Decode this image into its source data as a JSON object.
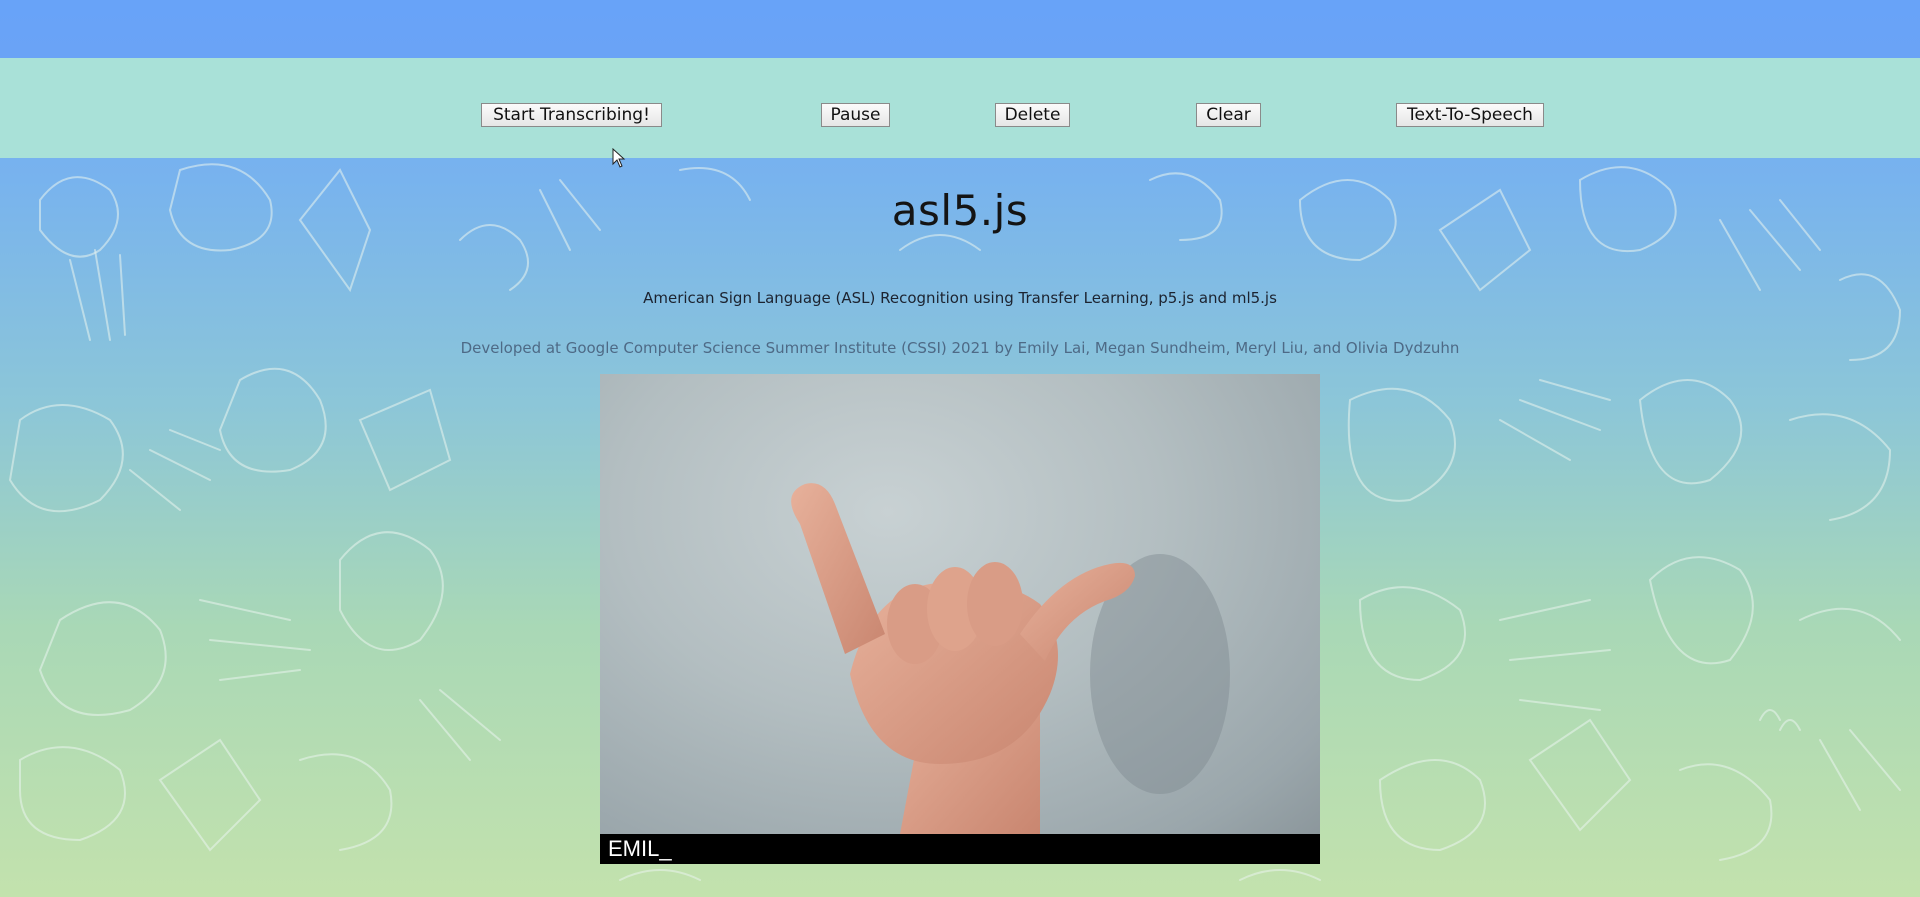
{
  "toolbar": {
    "start_label": "Start Transcribing!",
    "pause_label": "Pause",
    "delete_label": "Delete",
    "clear_label": "Clear",
    "tts_label": "Text-To-Speech"
  },
  "header": {
    "title": "asl5.js",
    "subtitle": "American Sign Language (ASL) Recognition using Transfer Learning, p5.js and ml5.js",
    "credits": "Developed at Google Computer Science Summer Institute (CSSI) 2021 by Emily Lai, Megan Sundheim, Meryl Liu, and Olivia Dydzuhn"
  },
  "video": {
    "caption": "EMIL_",
    "subject": "hand-sign-y"
  },
  "colors": {
    "top_strip": "#68a3f8",
    "toolbar": "#a9e1d8",
    "caption_bg": "#000000"
  }
}
